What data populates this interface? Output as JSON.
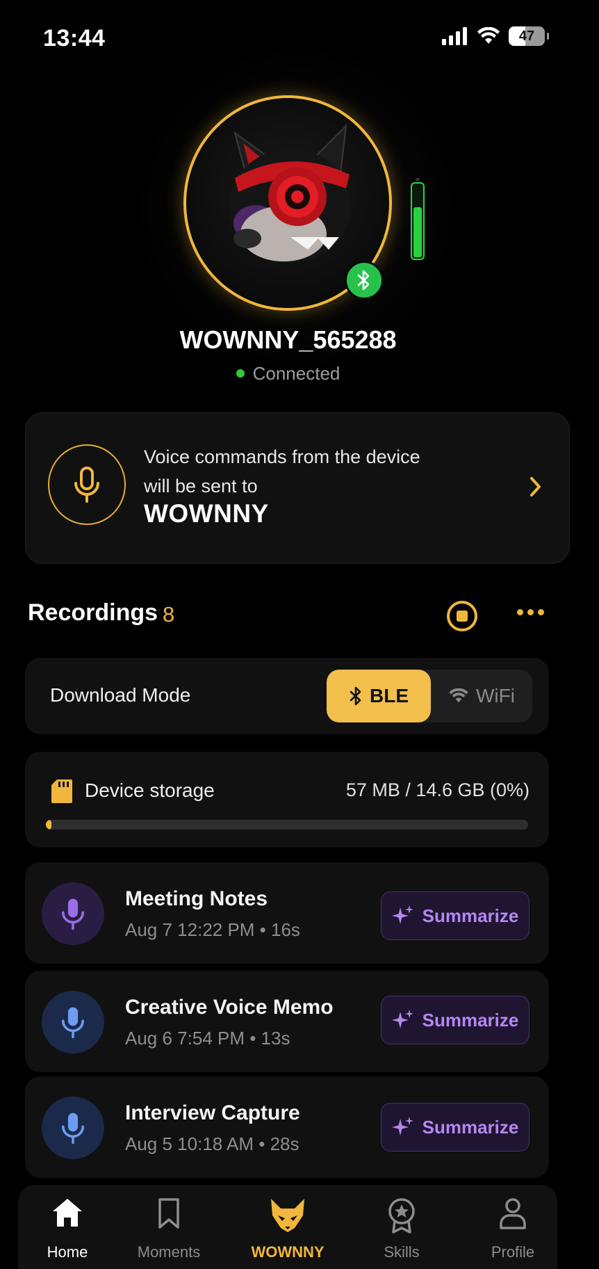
{
  "status_bar": {
    "time": "13:44",
    "battery": "47",
    "battery_level": 0.47
  },
  "device": {
    "name": "WOWNNY_565288",
    "status": "Connected",
    "battery_level": 0.7,
    "status_color": "#2ecc40"
  },
  "voice_card": {
    "line1": "Voice commands from the device",
    "line2": "will be sent to",
    "target": "WOWNNY"
  },
  "recordings": {
    "title": "Recordings",
    "count": "8",
    "download_mode": {
      "label": "Download Mode",
      "options": [
        "BLE",
        "WiFi"
      ],
      "selected": "BLE"
    },
    "storage": {
      "label": "Device storage",
      "value": "57 MB / 14.6 GB (0%)",
      "used_fraction": 0.004
    },
    "items": [
      {
        "title": "Meeting Notes",
        "meta": "Aug 7 12:22 PM • 16s",
        "action": "Summarize",
        "icon": "mic-icon",
        "icon_color": "#9a6ee8"
      },
      {
        "title": "Creative Voice Memo",
        "meta": "Aug 6 7:54 PM • 13s",
        "action": "Summarize",
        "icon": "mic-icon",
        "icon_color": "#6e9cf0"
      },
      {
        "title": "Interview Capture",
        "meta": "Aug 5 10:18 AM • 28s",
        "action": "Summarize",
        "icon": "mic-icon",
        "icon_color": "#6e9cf0"
      }
    ]
  },
  "tabs": [
    {
      "label": "Home",
      "icon": "home-icon"
    },
    {
      "label": "Moments",
      "icon": "bookmark-icon"
    },
    {
      "label": "WOWNNY",
      "icon": "wolf-icon"
    },
    {
      "label": "Skills",
      "icon": "badge-icon"
    },
    {
      "label": "Profile",
      "icon": "person-icon"
    }
  ],
  "colors": {
    "accent": "#f0b73c",
    "purple": "#b487f2",
    "green": "#27c24c"
  }
}
